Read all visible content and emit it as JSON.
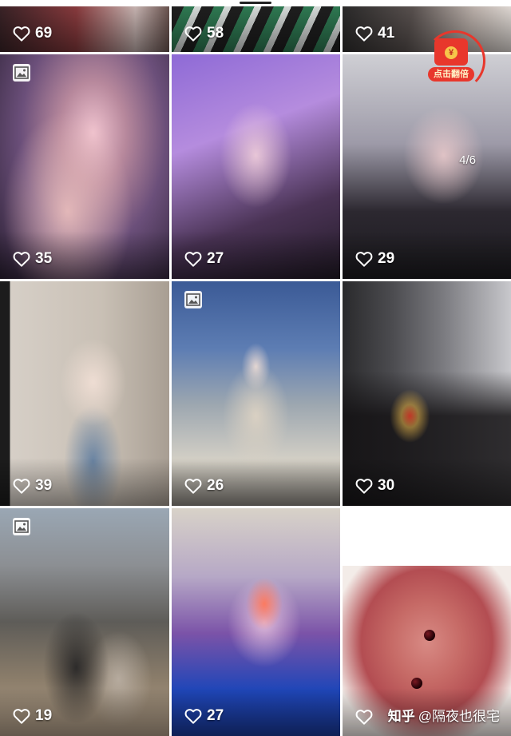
{
  "grid": {
    "posts": [
      {
        "likes": "69",
        "has_image_badge": false
      },
      {
        "likes": "58",
        "has_image_badge": false
      },
      {
        "likes": "41",
        "has_image_badge": false
      },
      {
        "likes": "35",
        "has_image_badge": true
      },
      {
        "likes": "27",
        "has_image_badge": false
      },
      {
        "likes": "29",
        "has_image_badge": false
      },
      {
        "likes": "39",
        "has_image_badge": false
      },
      {
        "likes": "26",
        "has_image_badge": true
      },
      {
        "likes": "30",
        "has_image_badge": false
      },
      {
        "likes": "19",
        "has_image_badge": true
      },
      {
        "likes": "27",
        "has_image_badge": false
      },
      {
        "likes": "",
        "has_image_badge": false
      }
    ]
  },
  "red_packet": {
    "label": "点击翻倍",
    "coin_symbol": "¥"
  },
  "carousel_counter": "4/6",
  "watermark": {
    "site": "知乎",
    "author": "@隔夜也很宅"
  },
  "colors": {
    "accent": "#e8372c",
    "text_on_image": "#ffffff"
  }
}
